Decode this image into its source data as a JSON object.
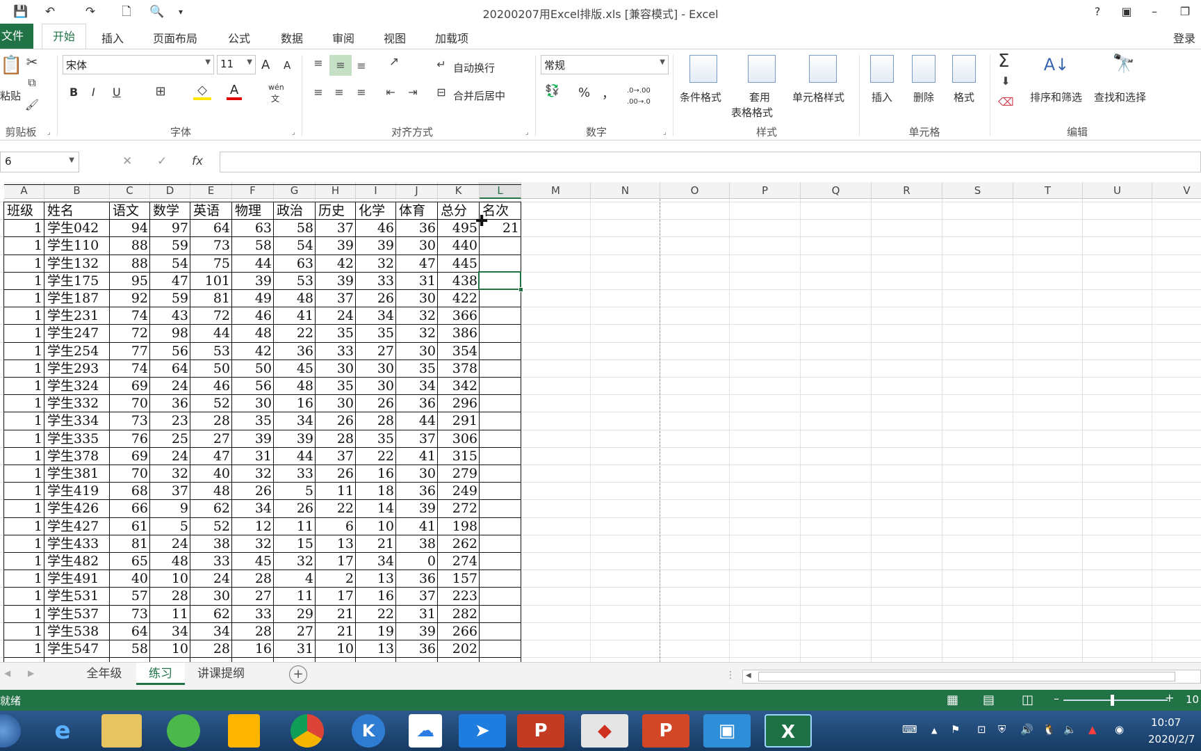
{
  "window": {
    "title": "20200207用Excel排版.xls  [兼容模式] - Excel",
    "help": "?",
    "restore_ribbon": "▣",
    "minimize": "–",
    "maximize": "❐"
  },
  "tabs": {
    "file": "文件",
    "home": "开始",
    "insert": "插入",
    "layout": "页面布局",
    "formulas": "公式",
    "data": "数据",
    "review": "审阅",
    "view": "视图",
    "addins": "加载项",
    "login": "登录"
  },
  "ribbon": {
    "clipboard": {
      "paste": "粘贴",
      "group": "剪贴板"
    },
    "font": {
      "name": "宋体",
      "size": "11",
      "grow": "A",
      "shrink": "A",
      "bold": "B",
      "italic": "I",
      "underline": "U",
      "phonetic": "wén",
      "phonetic_sub": "文",
      "group": "字体"
    },
    "align": {
      "wrap": "自动换行",
      "merge": "合并后居中",
      "group": "对齐方式"
    },
    "number": {
      "format": "常规",
      "percent": "%",
      "comma": "，",
      "inc": ".0→.00",
      "dec": ".00→.0",
      "group": "数字"
    },
    "styles": {
      "cond": "条件格式",
      "table1": "套用",
      "table2": "表格格式",
      "cellstyle": "单元格样式",
      "group": "样式"
    },
    "cells": {
      "insert": "插入",
      "delete": "删除",
      "format": "格式",
      "group": "单元格"
    },
    "edit": {
      "sigma": "Σ",
      "sortfilter": "排序和筛选",
      "find": "查找和选择",
      "group": "编辑"
    }
  },
  "formula_bar": {
    "namebox": "6",
    "fx": "fx",
    "cancel": "✕",
    "enter": "✓"
  },
  "columns": [
    "A",
    "B",
    "C",
    "D",
    "E",
    "F",
    "G",
    "H",
    "I",
    "J",
    "K",
    "L",
    "M",
    "N",
    "O",
    "P",
    "Q",
    "R",
    "S",
    "T",
    "U",
    "V"
  ],
  "header_row": [
    "班级",
    "姓名",
    "语文",
    "数学",
    "英语",
    "物理",
    "政治",
    "历史",
    "化学",
    "体育",
    "总分",
    "名次"
  ],
  "rows": [
    [
      "1",
      "学生042",
      "94",
      "97",
      "64",
      "63",
      "58",
      "37",
      "46",
      "36",
      "495",
      "21"
    ],
    [
      "1",
      "学生110",
      "88",
      "59",
      "73",
      "58",
      "54",
      "39",
      "39",
      "30",
      "440",
      ""
    ],
    [
      "1",
      "学生132",
      "88",
      "54",
      "75",
      "44",
      "63",
      "42",
      "32",
      "47",
      "445",
      ""
    ],
    [
      "1",
      "学生175",
      "95",
      "47",
      "101",
      "39",
      "53",
      "39",
      "33",
      "31",
      "438",
      ""
    ],
    [
      "1",
      "学生187",
      "92",
      "59",
      "81",
      "49",
      "48",
      "37",
      "26",
      "30",
      "422",
      ""
    ],
    [
      "1",
      "学生231",
      "74",
      "43",
      "72",
      "46",
      "41",
      "24",
      "34",
      "32",
      "366",
      ""
    ],
    [
      "1",
      "学生247",
      "72",
      "98",
      "44",
      "48",
      "22",
      "35",
      "35",
      "32",
      "386",
      ""
    ],
    [
      "1",
      "学生254",
      "77",
      "56",
      "53",
      "42",
      "36",
      "33",
      "27",
      "30",
      "354",
      ""
    ],
    [
      "1",
      "学生293",
      "74",
      "64",
      "50",
      "50",
      "45",
      "30",
      "30",
      "35",
      "378",
      ""
    ],
    [
      "1",
      "学生324",
      "69",
      "24",
      "46",
      "56",
      "48",
      "35",
      "30",
      "34",
      "342",
      ""
    ],
    [
      "1",
      "学生332",
      "70",
      "36",
      "52",
      "30",
      "16",
      "30",
      "26",
      "36",
      "296",
      ""
    ],
    [
      "1",
      "学生334",
      "73",
      "23",
      "28",
      "35",
      "34",
      "26",
      "28",
      "44",
      "291",
      ""
    ],
    [
      "1",
      "学生335",
      "76",
      "25",
      "27",
      "39",
      "39",
      "28",
      "35",
      "37",
      "306",
      ""
    ],
    [
      "1",
      "学生378",
      "69",
      "24",
      "47",
      "31",
      "44",
      "37",
      "22",
      "41",
      "315",
      ""
    ],
    [
      "1",
      "学生381",
      "70",
      "32",
      "40",
      "32",
      "33",
      "26",
      "16",
      "30",
      "279",
      ""
    ],
    [
      "1",
      "学生419",
      "68",
      "37",
      "48",
      "26",
      "5",
      "11",
      "18",
      "36",
      "249",
      ""
    ],
    [
      "1",
      "学生426",
      "66",
      "9",
      "62",
      "34",
      "26",
      "22",
      "14",
      "39",
      "272",
      ""
    ],
    [
      "1",
      "学生427",
      "61",
      "5",
      "52",
      "12",
      "11",
      "6",
      "10",
      "41",
      "198",
      ""
    ],
    [
      "1",
      "学生433",
      "81",
      "24",
      "38",
      "32",
      "15",
      "13",
      "21",
      "38",
      "262",
      ""
    ],
    [
      "1",
      "学生482",
      "65",
      "48",
      "33",
      "45",
      "32",
      "17",
      "34",
      "0",
      "274",
      ""
    ],
    [
      "1",
      "学生491",
      "40",
      "10",
      "24",
      "28",
      "4",
      "2",
      "13",
      "36",
      "157",
      ""
    ],
    [
      "1",
      "学生531",
      "57",
      "28",
      "30",
      "27",
      "11",
      "17",
      "16",
      "37",
      "223",
      ""
    ],
    [
      "1",
      "学生537",
      "73",
      "11",
      "62",
      "33",
      "29",
      "21",
      "22",
      "31",
      "282",
      ""
    ],
    [
      "1",
      "学生538",
      "64",
      "34",
      "34",
      "28",
      "27",
      "21",
      "19",
      "39",
      "266",
      ""
    ],
    [
      "1",
      "学生547",
      "58",
      "10",
      "28",
      "16",
      "31",
      "10",
      "13",
      "36",
      "202",
      ""
    ]
  ],
  "sheets": [
    "全年级",
    "练习",
    "讲课提纲"
  ],
  "sheet_add": "+",
  "status": {
    "mode": "就绪",
    "zoom": "10"
  },
  "taskbar": {
    "time": "10:07",
    "date": "2020/2/7"
  },
  "colors": {
    "accent": "#217346",
    "taskbar": "#1f4a7a"
  }
}
